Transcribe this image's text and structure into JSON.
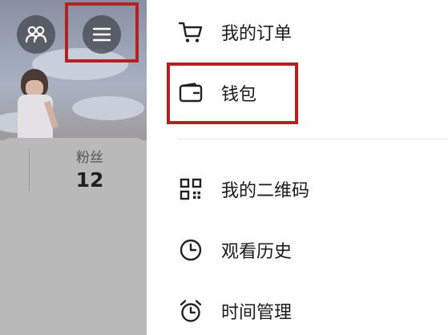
{
  "profile": {
    "fans_label": "粉丝",
    "fans_count": "12"
  },
  "header": {
    "friends_icon": "friends-icon",
    "menu_icon": "hamburger-menu-icon"
  },
  "drawer": {
    "items": [
      {
        "label": "我的订单",
        "icon": "cart-icon"
      },
      {
        "label": "钱包",
        "icon": "wallet-icon"
      },
      {
        "label": "我的二维码",
        "icon": "qrcode-icon"
      },
      {
        "label": "观看历史",
        "icon": "clock-icon"
      },
      {
        "label": "时间管理",
        "icon": "alarm-clock-icon"
      }
    ]
  },
  "colors": {
    "highlight": "#b22222",
    "overlay": "#b9b9b9",
    "text": "#1a1a1a"
  }
}
